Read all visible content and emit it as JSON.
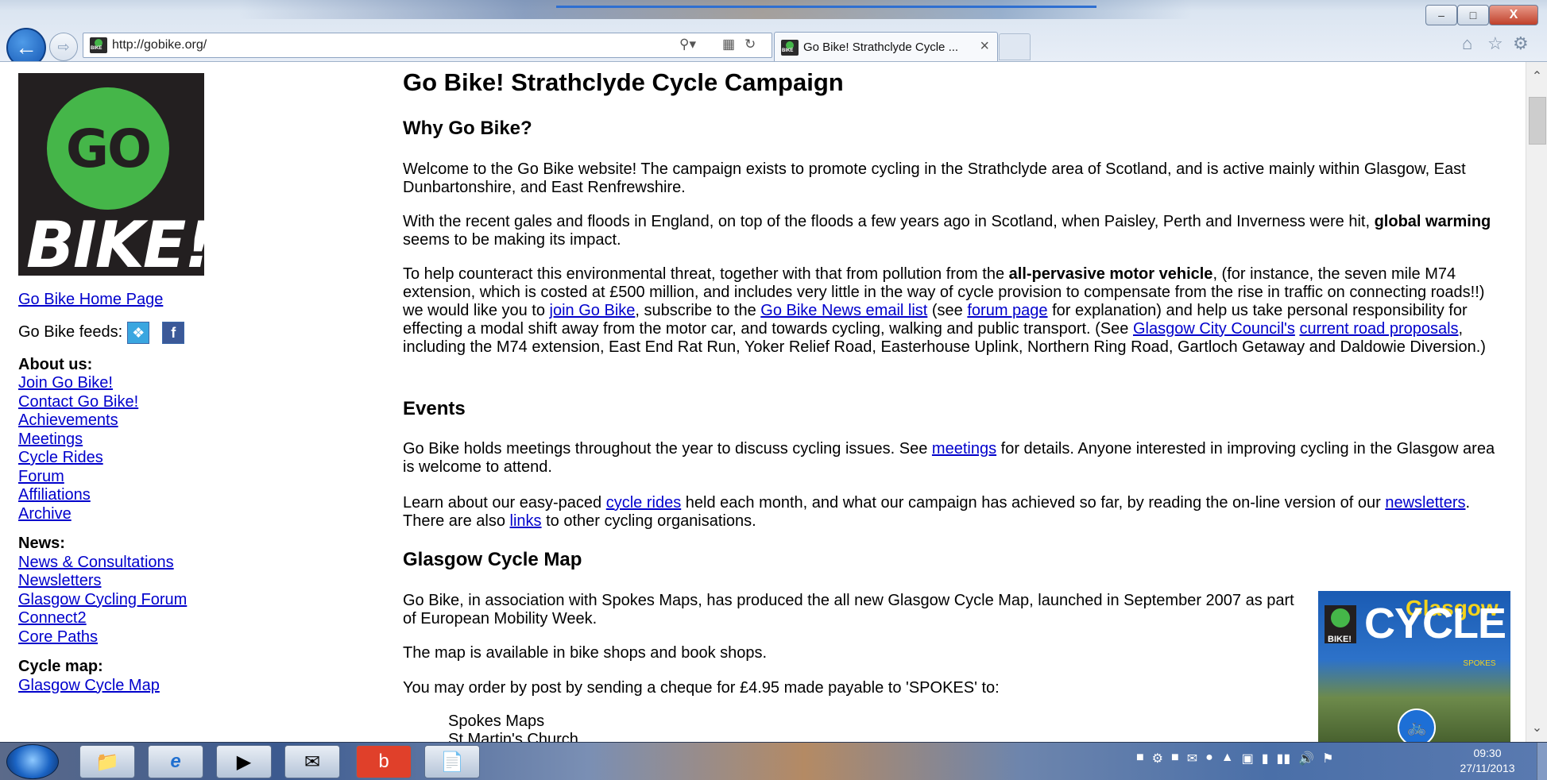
{
  "browser": {
    "url": "http://gobike.org/",
    "tab_title": "Go Bike! Strathclyde Cycle ...",
    "tab_close": "×",
    "window_min": "–",
    "window_max": "□",
    "window_close": "X"
  },
  "logo": {
    "circle_text": "GO",
    "word": "BIKE!"
  },
  "sidebar": {
    "home_link": "Go Bike Home Page",
    "feeds_label": "Go Bike feeds:",
    "about": {
      "heading": "About us:",
      "links": [
        "Join Go Bike!",
        "Contact Go Bike!",
        "Achievements",
        "Meetings",
        "Cycle Rides",
        "Forum",
        "Affiliations",
        "Archive"
      ]
    },
    "news": {
      "heading": "News:",
      "links": [
        "News & Consultations",
        "Newsletters",
        "Glasgow Cycling Forum",
        "Connect2",
        "Core Paths"
      ]
    },
    "map": {
      "heading": "Cycle map:",
      "links": [
        "Glasgow Cycle Map"
      ]
    }
  },
  "content": {
    "title": "Go Bike! Strathclyde Cycle Campaign",
    "why": {
      "heading": "Why Go Bike?",
      "p1": "Welcome to the Go Bike website! The campaign exists to promote cycling in the Strathclyde area of Scotland, and is active mainly within Glasgow, East Dunbartonshire, and East Renfrewshire.",
      "p2_a": "With the recent gales and floods in England, on top of the floods a few years ago in Scotland, when Paisley, Perth and Inverness were hit, ",
      "p2_bold": "global warming",
      "p2_b": " seems to be making its impact.",
      "p3_a": "To help counteract this environmental threat, together with that from pollution from the ",
      "p3_bold": "all-pervasive motor vehicle",
      "p3_b": ", (for instance, the seven mile M74 extension, which is costed at £500 million, and includes very little in the way of cycle provision to compensate from the rise in traffic on connecting roads!!) we would like you to ",
      "p3_link1": "join Go Bike",
      "p3_c": ", subscribe to the ",
      "p3_link2": "Go Bike News email list",
      "p3_d": " (see ",
      "p3_link3": "forum page",
      "p3_e": " for explanation) and help us take personal responsibility for effecting a modal shift away from the motor car, and towards cycling, walking and public transport. (See ",
      "p3_link4": "Glasgow City Council's",
      "p3_f": " ",
      "p3_link5": "current road proposals",
      "p3_g": ", including the M74 extension, East End Rat Run, Yoker Relief Road, Easterhouse Uplink, Northern Ring Road, Gartloch Getaway and Daldowie Diversion.)"
    },
    "events": {
      "heading": "Events",
      "p1_a": "Go Bike holds meetings throughout the year to discuss cycling issues. See ",
      "p1_link": "meetings",
      "p1_b": " for details. Anyone interested in improving cycling in the Glasgow area is welcome to attend.",
      "p2_a": "Learn about our easy-paced ",
      "p2_link1": "cycle rides",
      "p2_b": " held each month, and what our campaign has achieved so far, by reading the on-line version of our ",
      "p2_link2": "newsletters",
      "p2_c": ". There are also ",
      "p2_link3": "links",
      "p2_d": " to other cycling organisations."
    },
    "map": {
      "heading": "Glasgow Cycle Map",
      "p1": "Go Bike, in association with Spokes Maps, has produced the all new Glasgow Cycle Map, launched in September 2007 as part of European Mobility Week.",
      "p2": "The map is available in bike shops and book shops.",
      "p3": "You may order by post by sending a cheque for £4.95 made payable to 'SPOKES' to:",
      "address_line1": "Spokes Maps",
      "address_line2": "St Martin's Church",
      "image": {
        "logo_text": "BIKE!",
        "title1": "Glasgow",
        "title2": "CYCLE",
        "badge": "SPOKES"
      }
    }
  },
  "taskbar": {
    "time": "09:30",
    "date": "27/11/2013"
  }
}
